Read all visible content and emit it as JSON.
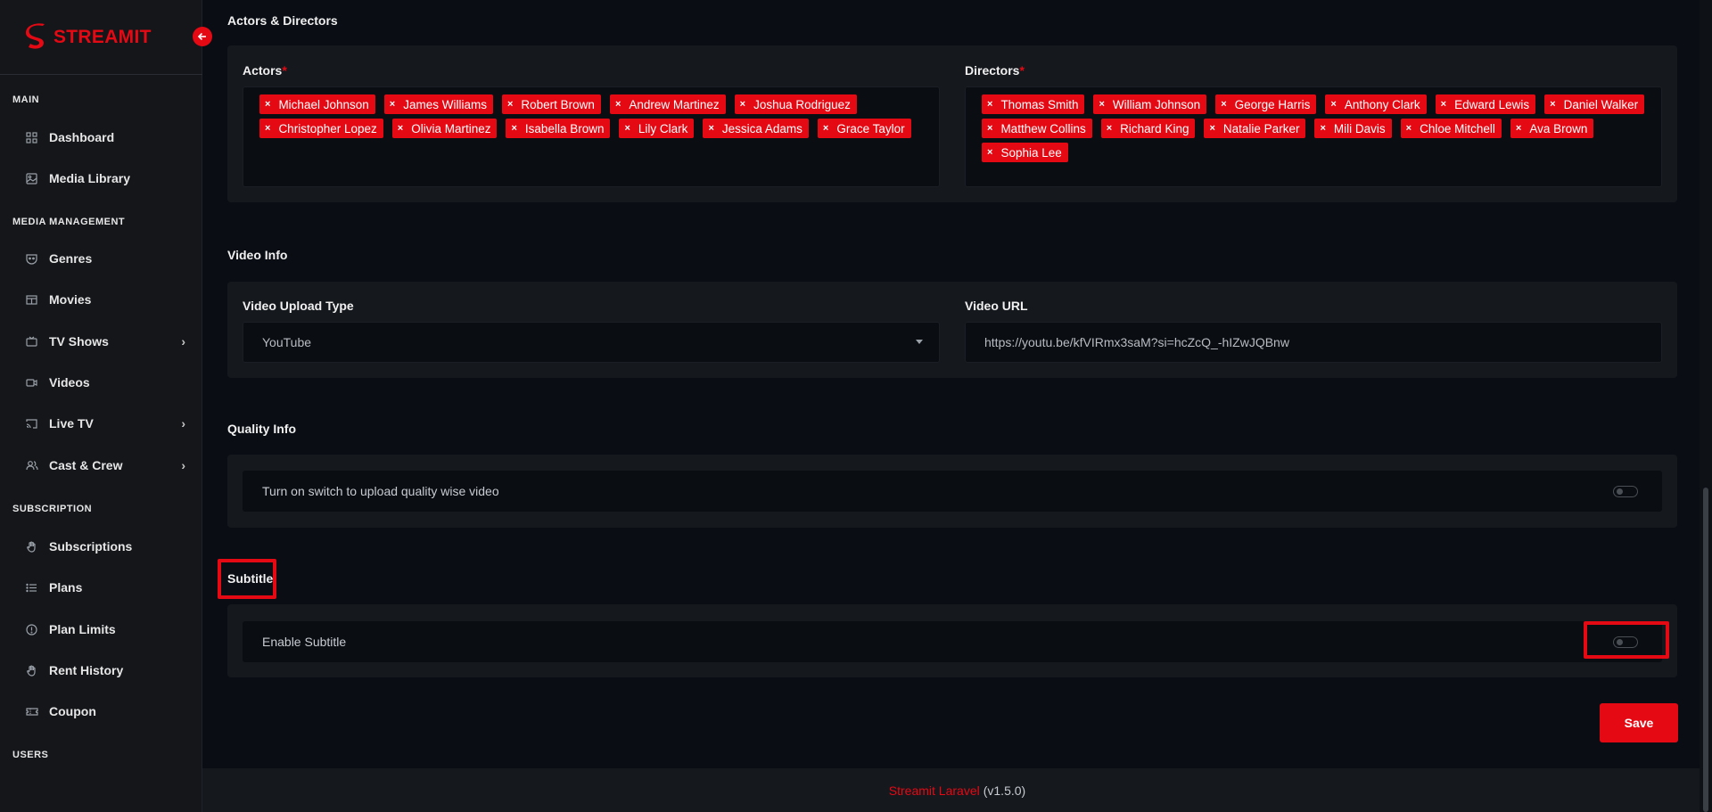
{
  "brand": {
    "name": "STREAMIT",
    "accent": "#e50914"
  },
  "sidebar": {
    "collapse_icon": "arrow-left-icon",
    "sections": {
      "main": "MAIN",
      "media": "MEDIA MANAGEMENT",
      "subscription": "SUBSCRIPTION",
      "users": "USERS"
    },
    "items": [
      {
        "label": "Dashboard",
        "icon": "grid-icon"
      },
      {
        "label": "Media Library",
        "icon": "image-icon"
      },
      {
        "label": "Genres",
        "icon": "mask-icon"
      },
      {
        "label": "Movies",
        "icon": "film-icon"
      },
      {
        "label": "TV Shows",
        "icon": "tv-icon"
      },
      {
        "label": "Videos",
        "icon": "video-icon"
      },
      {
        "label": "Live TV",
        "icon": "cast-icon"
      },
      {
        "label": "Cast & Crew",
        "icon": "people-icon"
      },
      {
        "label": "Subscriptions",
        "icon": "hand-icon"
      },
      {
        "label": "Plans",
        "icon": "list-icon"
      },
      {
        "label": "Plan Limits",
        "icon": "info-icon"
      },
      {
        "label": "Rent History",
        "icon": "hand-icon"
      },
      {
        "label": "Coupon",
        "icon": "ticket-icon"
      }
    ]
  },
  "actors_directors": {
    "title": "Actors & Directors",
    "actors_label": "Actors",
    "directors_label": "Directors",
    "required_mark": "*",
    "remove_glyph": "×",
    "actors": [
      "Michael Johnson",
      "James Williams",
      "Robert Brown",
      "Andrew Martinez",
      "Joshua Rodriguez",
      "Christopher Lopez",
      "Olivia Martinez",
      "Isabella Brown",
      "Lily Clark",
      "Jessica Adams",
      "Grace Taylor"
    ],
    "directors": [
      "Thomas Smith",
      "William Johnson",
      "George Harris",
      "Anthony Clark",
      "Edward Lewis",
      "Daniel Walker",
      "Matthew Collins",
      "Richard King",
      "Natalie Parker",
      "Mili Davis",
      "Chloe Mitchell",
      "Ava Brown",
      "Sophia Lee"
    ]
  },
  "video_info": {
    "title": "Video Info",
    "upload_type_label": "Video Upload Type",
    "upload_type_value": "YouTube",
    "url_label": "Video URL",
    "url_value": "https://youtu.be/kfVIRmx3saM?si=hcZcQ_-hIZwJQBnw"
  },
  "quality_info": {
    "title": "Quality Info",
    "switch_label": "Turn on switch to upload quality wise video",
    "enabled": false
  },
  "subtitle": {
    "title": "Subtitle",
    "switch_label": "Enable Subtitle",
    "enabled": false
  },
  "actions": {
    "save": "Save"
  },
  "footer": {
    "link": "Streamit Laravel",
    "version": "(v1.5.0)"
  }
}
